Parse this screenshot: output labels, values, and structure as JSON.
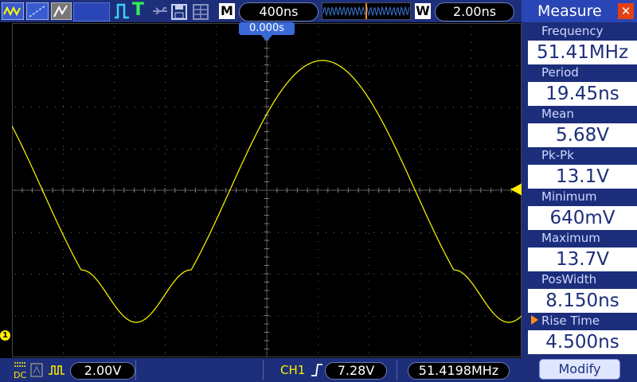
{
  "toolbar": {
    "m_tag": "M",
    "timebase": "400ns",
    "w_tag": "W",
    "window_time": "2.00ns"
  },
  "trigger_time": "0.000s",
  "channel_marker": "1",
  "bottom": {
    "volts_div": "2.00V",
    "channel": "CH1",
    "trigger_level": "7.28V",
    "frequency_counter": "51.4198MHz"
  },
  "measure": {
    "title": "Measure",
    "items": [
      {
        "label": "Frequency",
        "value": "51.41MHz"
      },
      {
        "label": "Period",
        "value": "19.45ns"
      },
      {
        "label": "Mean",
        "value": "5.68V"
      },
      {
        "label": "Pk-Pk",
        "value": "13.1V"
      },
      {
        "label": "Minimum",
        "value": "640mV"
      },
      {
        "label": "Maximum",
        "value": "13.7V"
      },
      {
        "label": "PosWidth",
        "value": "8.150ns"
      },
      {
        "label": "Rise Time",
        "value": "4.500ns"
      }
    ],
    "modify_label": "Modify"
  },
  "colors": {
    "trace": "#ffff00",
    "panel": "#1c2e7b",
    "accent": "#ff8c1a",
    "close": "#e64010"
  }
}
